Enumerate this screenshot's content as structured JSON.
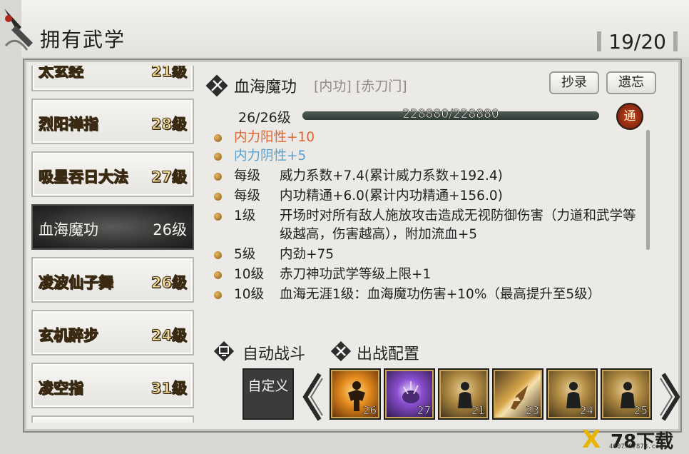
{
  "header": {
    "title": "拥有武学",
    "counter": "19/20"
  },
  "skill_list": [
    {
      "name": "太玄经",
      "level": "21级",
      "selected": false
    },
    {
      "name": "烈阳禅指",
      "level": "28级",
      "selected": false
    },
    {
      "name": "吸星吞日大法",
      "level": "27级",
      "selected": false
    },
    {
      "name": "血海魔功",
      "level": "26级",
      "selected": true
    },
    {
      "name": "凌波仙子舞",
      "level": "26级",
      "selected": false
    },
    {
      "name": "玄机醉步",
      "level": "24级",
      "selected": false
    },
    {
      "name": "凌空指",
      "level": "31级",
      "selected": false
    }
  ],
  "detail": {
    "name": "血海魔功",
    "tags": "[内功] [赤刀门]",
    "copy_button": "抄录",
    "forget_button": "遗忘",
    "level_text": "26/26级",
    "exp_text": "228880/228880",
    "exp_fraction": 1.0,
    "badge": "通",
    "effects": [
      {
        "prefix": "",
        "desc": "内力阳性+10",
        "style": "yang"
      },
      {
        "prefix": "",
        "desc": "内力阴性+5",
        "style": "yin"
      },
      {
        "prefix": "每级",
        "desc": "威力系数+7.4(累计威力系数+192.4)",
        "style": "normal"
      },
      {
        "prefix": "每级",
        "desc": "内功精通+6.0(累计内功精通+156.0)",
        "style": "normal"
      },
      {
        "prefix": "1级",
        "desc": "开场时对所有敌人施放攻击造成无视防御伤害（力道和武学等级越高，伤害越高），附加流血+5",
        "style": "normal"
      },
      {
        "prefix": "5级",
        "desc": "内劲+75",
        "style": "normal"
      },
      {
        "prefix": "10级",
        "desc": "赤刀神功武学等级上限+1",
        "style": "normal"
      },
      {
        "prefix": "10级",
        "desc": "血海无涯1级：血海魔功伤害+10%（最高提升至5级）",
        "style": "normal"
      }
    ]
  },
  "bottom": {
    "auto_battle": "自动战斗",
    "battle_config": "出战配置",
    "custom_button": "自定义",
    "slots": [
      {
        "level": "26",
        "icon": "fire-figure-icon",
        "kind": "fire"
      },
      {
        "level": "27",
        "icon": "purple-orb-icon",
        "kind": "purple"
      },
      {
        "level": "21",
        "icon": "meditating-figure-icon",
        "kind": "gold"
      },
      {
        "level": "23",
        "icon": "finger-strike-icon",
        "kind": "strike"
      },
      {
        "level": "24",
        "icon": "meditating-figure-icon",
        "kind": "gold"
      },
      {
        "level": "25",
        "icon": "meditating-figure-icon",
        "kind": "gold"
      }
    ]
  },
  "watermark": {
    "brand": "78下载",
    "url": "4007787878.com"
  }
}
